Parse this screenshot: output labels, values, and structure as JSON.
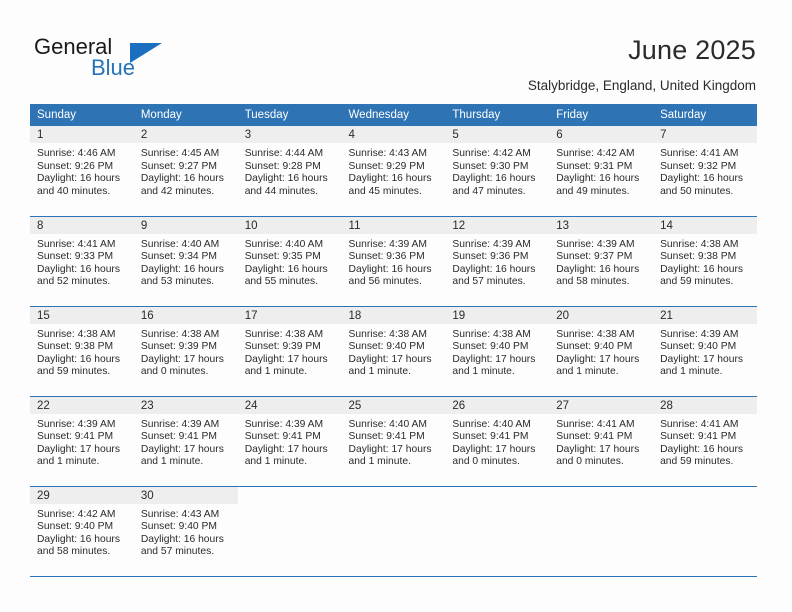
{
  "brand": {
    "name_part1": "General",
    "name_part2": "Blue",
    "accent_color": "#2573b8",
    "triangle_color": "#1a6fc0"
  },
  "header": {
    "title": "June 2025",
    "subtitle": "Stalybridge, England, United Kingdom"
  },
  "calendar": {
    "header_bg": "#2e73b4",
    "daynum_bg": "#eeeeee",
    "weekdays": [
      "Sunday",
      "Monday",
      "Tuesday",
      "Wednesday",
      "Thursday",
      "Friday",
      "Saturday"
    ],
    "weeks": [
      [
        {
          "day": "1",
          "sunrise": "Sunrise: 4:46 AM",
          "sunset": "Sunset: 9:26 PM",
          "daylight_line1": "Daylight: 16 hours",
          "daylight_line2": "and 40 minutes."
        },
        {
          "day": "2",
          "sunrise": "Sunrise: 4:45 AM",
          "sunset": "Sunset: 9:27 PM",
          "daylight_line1": "Daylight: 16 hours",
          "daylight_line2": "and 42 minutes."
        },
        {
          "day": "3",
          "sunrise": "Sunrise: 4:44 AM",
          "sunset": "Sunset: 9:28 PM",
          "daylight_line1": "Daylight: 16 hours",
          "daylight_line2": "and 44 minutes."
        },
        {
          "day": "4",
          "sunrise": "Sunrise: 4:43 AM",
          "sunset": "Sunset: 9:29 PM",
          "daylight_line1": "Daylight: 16 hours",
          "daylight_line2": "and 45 minutes."
        },
        {
          "day": "5",
          "sunrise": "Sunrise: 4:42 AM",
          "sunset": "Sunset: 9:30 PM",
          "daylight_line1": "Daylight: 16 hours",
          "daylight_line2": "and 47 minutes."
        },
        {
          "day": "6",
          "sunrise": "Sunrise: 4:42 AM",
          "sunset": "Sunset: 9:31 PM",
          "daylight_line1": "Daylight: 16 hours",
          "daylight_line2": "and 49 minutes."
        },
        {
          "day": "7",
          "sunrise": "Sunrise: 4:41 AM",
          "sunset": "Sunset: 9:32 PM",
          "daylight_line1": "Daylight: 16 hours",
          "daylight_line2": "and 50 minutes."
        }
      ],
      [
        {
          "day": "8",
          "sunrise": "Sunrise: 4:41 AM",
          "sunset": "Sunset: 9:33 PM",
          "daylight_line1": "Daylight: 16 hours",
          "daylight_line2": "and 52 minutes."
        },
        {
          "day": "9",
          "sunrise": "Sunrise: 4:40 AM",
          "sunset": "Sunset: 9:34 PM",
          "daylight_line1": "Daylight: 16 hours",
          "daylight_line2": "and 53 minutes."
        },
        {
          "day": "10",
          "sunrise": "Sunrise: 4:40 AM",
          "sunset": "Sunset: 9:35 PM",
          "daylight_line1": "Daylight: 16 hours",
          "daylight_line2": "and 55 minutes."
        },
        {
          "day": "11",
          "sunrise": "Sunrise: 4:39 AM",
          "sunset": "Sunset: 9:36 PM",
          "daylight_line1": "Daylight: 16 hours",
          "daylight_line2": "and 56 minutes."
        },
        {
          "day": "12",
          "sunrise": "Sunrise: 4:39 AM",
          "sunset": "Sunset: 9:36 PM",
          "daylight_line1": "Daylight: 16 hours",
          "daylight_line2": "and 57 minutes."
        },
        {
          "day": "13",
          "sunrise": "Sunrise: 4:39 AM",
          "sunset": "Sunset: 9:37 PM",
          "daylight_line1": "Daylight: 16 hours",
          "daylight_line2": "and 58 minutes."
        },
        {
          "day": "14",
          "sunrise": "Sunrise: 4:38 AM",
          "sunset": "Sunset: 9:38 PM",
          "daylight_line1": "Daylight: 16 hours",
          "daylight_line2": "and 59 minutes."
        }
      ],
      [
        {
          "day": "15",
          "sunrise": "Sunrise: 4:38 AM",
          "sunset": "Sunset: 9:38 PM",
          "daylight_line1": "Daylight: 16 hours",
          "daylight_line2": "and 59 minutes."
        },
        {
          "day": "16",
          "sunrise": "Sunrise: 4:38 AM",
          "sunset": "Sunset: 9:39 PM",
          "daylight_line1": "Daylight: 17 hours",
          "daylight_line2": "and 0 minutes."
        },
        {
          "day": "17",
          "sunrise": "Sunrise: 4:38 AM",
          "sunset": "Sunset: 9:39 PM",
          "daylight_line1": "Daylight: 17 hours",
          "daylight_line2": "and 1 minute."
        },
        {
          "day": "18",
          "sunrise": "Sunrise: 4:38 AM",
          "sunset": "Sunset: 9:40 PM",
          "daylight_line1": "Daylight: 17 hours",
          "daylight_line2": "and 1 minute."
        },
        {
          "day": "19",
          "sunrise": "Sunrise: 4:38 AM",
          "sunset": "Sunset: 9:40 PM",
          "daylight_line1": "Daylight: 17 hours",
          "daylight_line2": "and 1 minute."
        },
        {
          "day": "20",
          "sunrise": "Sunrise: 4:38 AM",
          "sunset": "Sunset: 9:40 PM",
          "daylight_line1": "Daylight: 17 hours",
          "daylight_line2": "and 1 minute."
        },
        {
          "day": "21",
          "sunrise": "Sunrise: 4:39 AM",
          "sunset": "Sunset: 9:40 PM",
          "daylight_line1": "Daylight: 17 hours",
          "daylight_line2": "and 1 minute."
        }
      ],
      [
        {
          "day": "22",
          "sunrise": "Sunrise: 4:39 AM",
          "sunset": "Sunset: 9:41 PM",
          "daylight_line1": "Daylight: 17 hours",
          "daylight_line2": "and 1 minute."
        },
        {
          "day": "23",
          "sunrise": "Sunrise: 4:39 AM",
          "sunset": "Sunset: 9:41 PM",
          "daylight_line1": "Daylight: 17 hours",
          "daylight_line2": "and 1 minute."
        },
        {
          "day": "24",
          "sunrise": "Sunrise: 4:39 AM",
          "sunset": "Sunset: 9:41 PM",
          "daylight_line1": "Daylight: 17 hours",
          "daylight_line2": "and 1 minute."
        },
        {
          "day": "25",
          "sunrise": "Sunrise: 4:40 AM",
          "sunset": "Sunset: 9:41 PM",
          "daylight_line1": "Daylight: 17 hours",
          "daylight_line2": "and 1 minute."
        },
        {
          "day": "26",
          "sunrise": "Sunrise: 4:40 AM",
          "sunset": "Sunset: 9:41 PM",
          "daylight_line1": "Daylight: 17 hours",
          "daylight_line2": "and 0 minutes."
        },
        {
          "day": "27",
          "sunrise": "Sunrise: 4:41 AM",
          "sunset": "Sunset: 9:41 PM",
          "daylight_line1": "Daylight: 17 hours",
          "daylight_line2": "and 0 minutes."
        },
        {
          "day": "28",
          "sunrise": "Sunrise: 4:41 AM",
          "sunset": "Sunset: 9:41 PM",
          "daylight_line1": "Daylight: 16 hours",
          "daylight_line2": "and 59 minutes."
        }
      ],
      [
        {
          "day": "29",
          "sunrise": "Sunrise: 4:42 AM",
          "sunset": "Sunset: 9:40 PM",
          "daylight_line1": "Daylight: 16 hours",
          "daylight_line2": "and 58 minutes."
        },
        {
          "day": "30",
          "sunrise": "Sunrise: 4:43 AM",
          "sunset": "Sunset: 9:40 PM",
          "daylight_line1": "Daylight: 16 hours",
          "daylight_line2": "and 57 minutes."
        },
        {
          "day": "",
          "sunrise": "",
          "sunset": "",
          "daylight_line1": "",
          "daylight_line2": ""
        },
        {
          "day": "",
          "sunrise": "",
          "sunset": "",
          "daylight_line1": "",
          "daylight_line2": ""
        },
        {
          "day": "",
          "sunrise": "",
          "sunset": "",
          "daylight_line1": "",
          "daylight_line2": ""
        },
        {
          "day": "",
          "sunrise": "",
          "sunset": "",
          "daylight_line1": "",
          "daylight_line2": ""
        },
        {
          "day": "",
          "sunrise": "",
          "sunset": "",
          "daylight_line1": "",
          "daylight_line2": ""
        }
      ]
    ]
  }
}
